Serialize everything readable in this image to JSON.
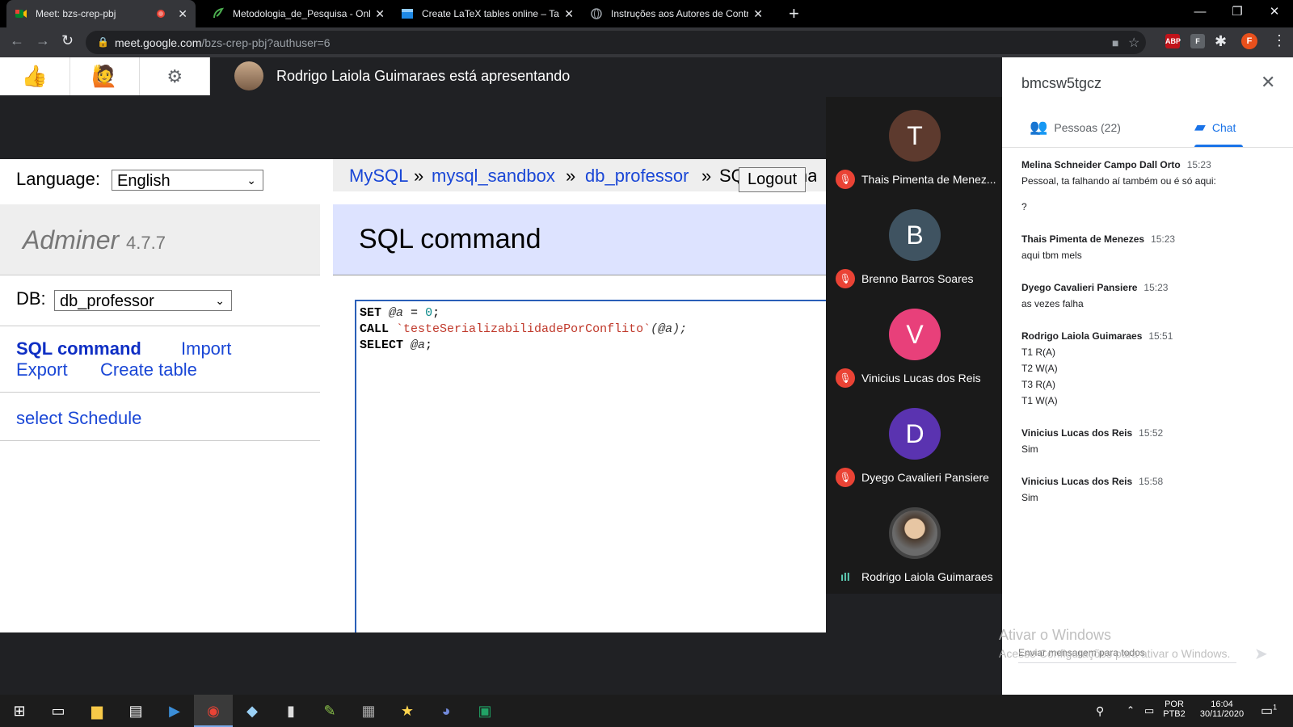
{
  "browser": {
    "tabs": [
      {
        "title": "Meet: bzs-crep-pbj",
        "active": true,
        "recording": true
      },
      {
        "title": "Metodologia_de_Pesquisa - Onli",
        "active": false
      },
      {
        "title": "Create LaTeX tables online – Tabl",
        "active": false
      },
      {
        "title": "Instruções aos Autores de Contri",
        "active": false
      }
    ],
    "url_host": "meet.google.com",
    "url_path": "/bzs-crep-pbj?authuser=6",
    "profile_initial": "F",
    "ext_abp": "ABP",
    "ext_f": "F"
  },
  "meet": {
    "presenting_text": "Rodrigo Laiola Guimaraes está apresentando",
    "reactions": [
      "👍",
      "🙋",
      "⚙"
    ],
    "participants": [
      {
        "initial": "T",
        "name": "Thais Pimenta de Menez...",
        "color": "#5d3a2e",
        "muted": true
      },
      {
        "initial": "B",
        "name": "Brenno Barros Soares",
        "color": "#3f5361",
        "muted": true
      },
      {
        "initial": "V",
        "name": "Vinicius Lucas dos Reis",
        "color": "#e8407a",
        "muted": true
      },
      {
        "initial": "D",
        "name": "Dyego Cavalieri Pansiere",
        "color": "#5a33b0",
        "muted": true
      },
      {
        "initial": "",
        "name": "Rodrigo Laiola Guimaraes",
        "color": "#555555",
        "muted": false
      }
    ]
  },
  "adminer": {
    "language_label": "Language:",
    "language_value": "English",
    "brand": "Adminer",
    "version": "4.7.7",
    "db_label": "DB:",
    "db_value": "db_professor",
    "links": {
      "sql_command": "SQL command",
      "import": "Import",
      "export": "Export",
      "create_table": "Create table",
      "select_schedule": "select Schedule"
    },
    "breadcrumb": [
      "MySQL",
      "mysql_sandbox",
      "db_professor",
      "SQL command"
    ],
    "breadcrumb_sep": "»",
    "logout": "Logout",
    "heading": "SQL command",
    "code": {
      "l1_kw": "SET",
      "l1_var": "@a",
      "l1_eq": " = ",
      "l1_num": "0",
      "l1_end": ";",
      "l2_kw": "CALL",
      "l2_str": "`testeSerializabilidadePorConflito`",
      "l2_args": "(@a);",
      "l3_kw": "SELECT",
      "l3_var": "@a",
      "l3_end": ";"
    }
  },
  "panel": {
    "meeting_code": "bmcsw5tgcz",
    "tab_people": "Pessoas (22)",
    "tab_chat": "Chat",
    "messages": [
      {
        "sender": "Melina Schneider Campo Dall Orto",
        "time": "15:23",
        "lines": [
          "Pessoal, ta falhando aí também ou é só aqui:",
          "?"
        ]
      },
      {
        "sender": "Thais Pimenta de Menezes",
        "time": "15:23",
        "lines": [
          "aqui tbm mels"
        ]
      },
      {
        "sender": "Dyego Cavalieri Pansiere",
        "time": "15:23",
        "lines": [
          "as vezes falha"
        ]
      },
      {
        "sender": "Rodrigo Laiola Guimaraes",
        "time": "15:51",
        "lines": [
          "T1 R(A)",
          "T2 W(A)",
          "T3 R(A)",
          "T1 W(A)"
        ]
      },
      {
        "sender": "Vinicius Lucas dos Reis",
        "time": "15:52",
        "lines": [
          "Sim"
        ]
      },
      {
        "sender": "Vinicius Lucas dos Reis",
        "time": "15:58",
        "lines": [
          "Sim"
        ]
      }
    ],
    "input_placeholder": "Enviar mensagem para todos",
    "watermark_title": "Ativar o Windows",
    "watermark_sub": "Acesse Configurações para ativar o Windows."
  },
  "taskbar": {
    "lang1": "POR",
    "lang2": "PTB2",
    "time": "16:04",
    "date": "30/11/2020",
    "notif_count": "1"
  }
}
